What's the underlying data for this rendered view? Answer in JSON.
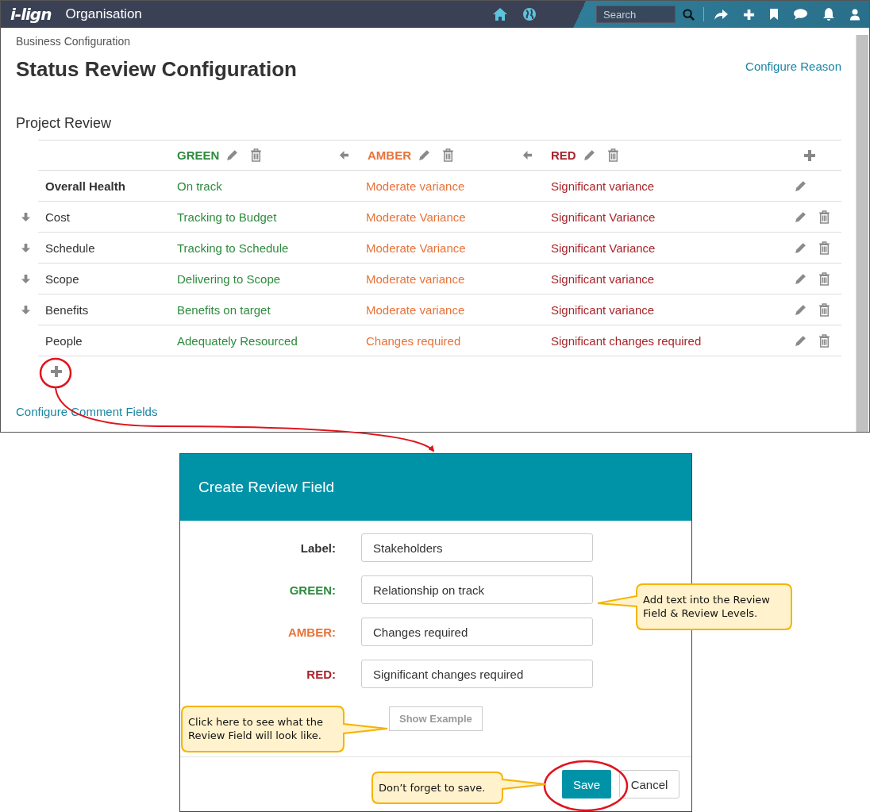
{
  "app_bar": {
    "logo": "i-lign",
    "title": "Organisation",
    "search": {
      "placeholder": "Search"
    }
  },
  "page": {
    "breadcrumb": "Business Configuration",
    "title": "Status Review Configuration",
    "configure_reason_link": "Configure Reason",
    "section_title": "Project Review",
    "configure_comment_link": "Configure Comment Fields"
  },
  "levels": [
    {
      "label": "GREEN",
      "color": "#2e8b3e",
      "move_left": false
    },
    {
      "label": "AMBER",
      "color": "#e8733a",
      "move_left": true
    },
    {
      "label": "RED",
      "color": "#a8252b",
      "move_left": true
    }
  ],
  "rows": [
    {
      "kind": "overall",
      "label": "Overall Health",
      "move_down": false,
      "values": [
        "On track",
        "Moderate variance",
        "Significant variance"
      ]
    },
    {
      "kind": "field",
      "label": "Cost",
      "move_down": true,
      "values": [
        "Tracking to Budget",
        "Moderate Variance",
        "Significant Variance"
      ]
    },
    {
      "kind": "field",
      "label": "Schedule",
      "move_down": true,
      "values": [
        "Tracking to Schedule",
        "Moderate Variance",
        "Significant Variance"
      ]
    },
    {
      "kind": "field",
      "label": "Scope",
      "move_down": true,
      "values": [
        "Delivering to Scope",
        "Moderate variance",
        "Significant variance"
      ]
    },
    {
      "kind": "field",
      "label": "Benefits",
      "move_down": true,
      "values": [
        "Benefits on target",
        "Moderate variance",
        "Significant variance"
      ]
    },
    {
      "kind": "field",
      "label": "People",
      "move_down": false,
      "values": [
        "Adequately Resourced",
        "Changes required",
        "Significant changes required"
      ]
    }
  ],
  "dialog": {
    "title": "Create Review Field",
    "fields": [
      {
        "label": "Label:",
        "value": "Stakeholders",
        "color": "#333333"
      },
      {
        "label": "GREEN:",
        "value": "Relationship on track",
        "color": "#2e8b3e"
      },
      {
        "label": "AMBER:",
        "value": "Changes required",
        "color": "#e8733a"
      },
      {
        "label": "RED:",
        "value": "Significant changes required",
        "color": "#a8252b"
      }
    ],
    "show_example_button": "Show Example",
    "save_button": "Save",
    "cancel_button": "Cancel"
  },
  "callouts": [
    {
      "text": "Add text into the Review Field & Review Levels."
    },
    {
      "text": "Click here to see what the Review Field will look like."
    },
    {
      "text": "Don’t forget to save."
    }
  ]
}
